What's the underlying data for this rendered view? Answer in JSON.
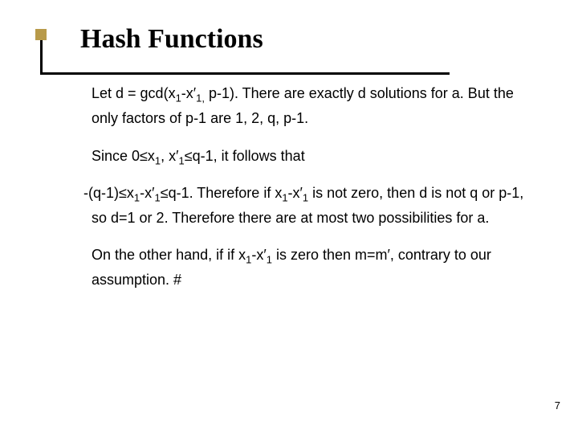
{
  "title": "Hash Functions",
  "para1_a": "Let d = gcd(x",
  "para1_b": "-x′",
  "para1_c": " p-1).  There are exactly d solutions for a.  But the only factors of p-1 are 1, 2, q, p-1.",
  "para2_a": "Since 0≤x",
  "para2_b": ", x′",
  "para2_c": "≤q-1, it follows that",
  "para3_a": "-(q-1)≤x",
  "para3_b": "-x′",
  "para3_c": "≤q-1. Therefore if x",
  "para3_d": "-x′",
  "para3_e": " is not zero, then d is not q or p-1, so d=1 or 2.  Therefore there are at most two possibilities for a.",
  "para4_a": "On the other hand, if if x",
  "para4_b": "-x′",
  "para4_c": " is zero then m=m′, contrary to our assumption.        #",
  "sub1": "1",
  "sub1comma": "1,",
  "pagenum": "7"
}
